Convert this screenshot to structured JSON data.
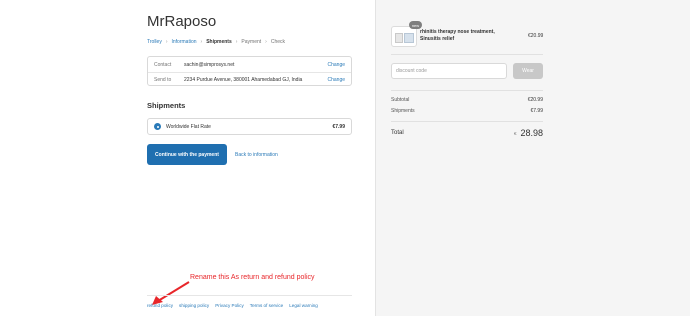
{
  "store": {
    "title": "MrRaposo"
  },
  "breadcrumb": [
    "Trolley",
    "Information",
    "Shipments",
    "Payment",
    "Check"
  ],
  "review": {
    "contact_label": "Contact",
    "contact_value": "sachin@simprosys.net",
    "send_label": "Send to",
    "send_value": "2234 Purdue Avenue, 380001 Ahamedabad GJ, India",
    "change_label": "Change"
  },
  "shipments": {
    "title": "Shipments",
    "option_name": "Worldwide Flat Rate",
    "option_price": "€7.99"
  },
  "actions": {
    "continue_label": "Continue with the payment",
    "back_label": "Back to information"
  },
  "annotation": {
    "text": "Rename this As return and refund policy"
  },
  "footer": [
    "refund policy",
    "shipping policy",
    "Privacy Policy",
    "Terms of service",
    "Legal warning"
  ],
  "summary": {
    "product_name": "rhinitis therapy nose treatment, Sinusitis relief",
    "product_badge": "new",
    "product_price": "€20.99",
    "discount_placeholder": "discount code",
    "apply_label": "Wear",
    "subtotal_label": "Subtotal",
    "subtotal_value": "€20.99",
    "shipments_label": "Shipments",
    "shipments_value": "€7.99",
    "total_label": "Total",
    "total_currency": "€",
    "total_value": "28.98"
  },
  "colors": {
    "link": "#2a7ab8",
    "button": "#1f6fb0",
    "annotation": "#e8262a"
  }
}
